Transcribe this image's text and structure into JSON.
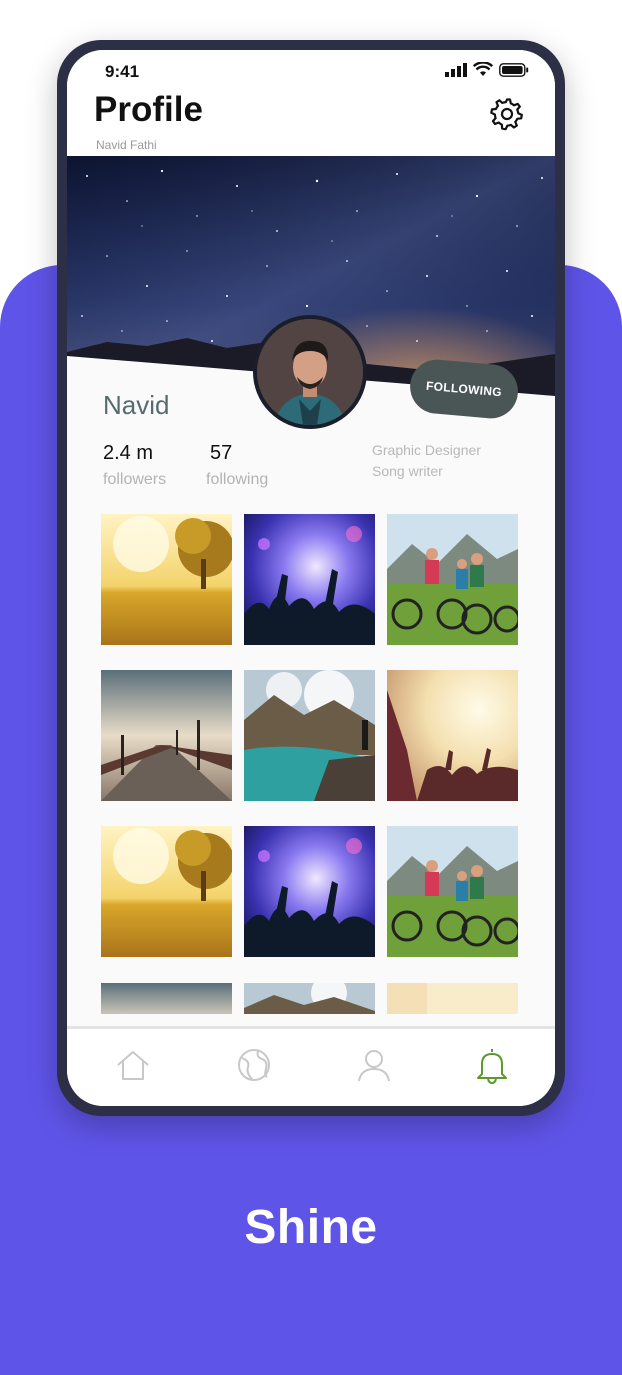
{
  "status": {
    "time": "9:41"
  },
  "header": {
    "title": "Profile",
    "subtitle": "Navid Fathi"
  },
  "profile": {
    "name": "Navid",
    "follow_label": "FOLLOWING",
    "stats": [
      {
        "value": "2.4 m",
        "label": "followers"
      },
      {
        "value": "57",
        "label": "following"
      }
    ],
    "bio": [
      "Graphic Designer",
      "Song writer"
    ]
  },
  "grid": {
    "photos": [
      "wheat-field",
      "concert-crowd",
      "cyclists-selfie",
      "pier-sunset",
      "mountain-lake",
      "festival-hands",
      "wheat-field",
      "concert-crowd",
      "cyclists-selfie",
      "pier-sunset",
      "mountain-lake",
      "festival-hands"
    ]
  },
  "tabs": [
    {
      "icon": "home-icon",
      "active": false
    },
    {
      "icon": "globe-icon",
      "active": false
    },
    {
      "icon": "user-icon",
      "active": false
    },
    {
      "icon": "bell-icon",
      "active": true
    }
  ],
  "colors": {
    "accent": "#5f54e8",
    "active_tab": "#5c9a2c",
    "follow_button": "#4a5656"
  },
  "tagline": "Shine"
}
